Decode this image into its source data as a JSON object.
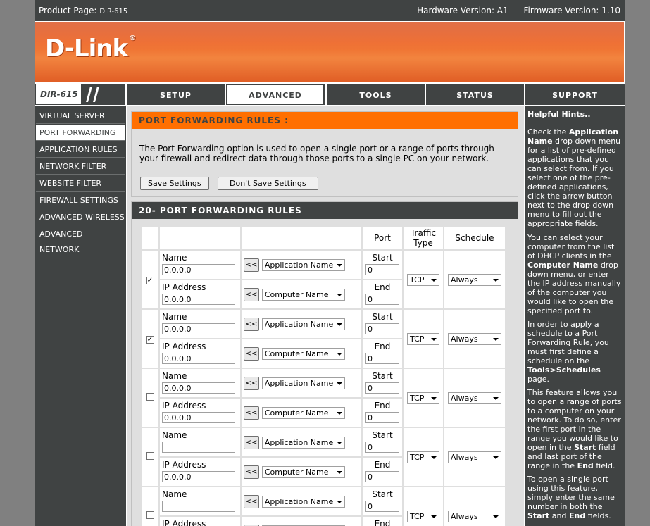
{
  "top": {
    "product_label": "Product Page:",
    "product_model": "DIR-615",
    "hardware": "Hardware Version: A1",
    "firmware": "Firmware Version: 1.10"
  },
  "brand": {
    "logo": "D-Link",
    "registered": "®"
  },
  "nav": {
    "model": "DIR-615",
    "tabs": [
      "SETUP",
      "ADVANCED",
      "TOOLS",
      "STATUS",
      "SUPPORT"
    ],
    "active_tab": "ADVANCED"
  },
  "sidebar": {
    "items": [
      "VIRTUAL SERVER",
      "PORT FORWARDING",
      "APPLICATION RULES",
      "NETWORK FILTER",
      "WEBSITE FILTER",
      "FIREWALL SETTINGS",
      "ADVANCED WIRELESS",
      "ADVANCED NETWORK"
    ],
    "active_item": "PORT FORWARDING"
  },
  "section1": {
    "title": "PORT FORWARDING RULES :",
    "description": "The Port Forwarding option is used to open a single port or a range of ports through your firewall and redirect data through those ports to a single PC on your network.",
    "save_button": "Save Settings",
    "dont_save_button": "Don't Save Settings"
  },
  "section2": {
    "title": "20- PORT FORWARDING RULES",
    "headers": {
      "port": "Port",
      "traffic_type": "Traffic Type",
      "schedule": "Schedule"
    },
    "labels": {
      "name": "Name",
      "ip_address": "IP Address",
      "start": "Start",
      "end": "End",
      "arrow": "<<",
      "application_name": "Application Name",
      "computer_name": "Computer Name"
    },
    "rules": [
      {
        "checked": true,
        "name": "0.0.0.0",
        "ip": "0.0.0.0",
        "start": "0",
        "end": "0",
        "traffic": "TCP",
        "schedule": "Always"
      },
      {
        "checked": true,
        "name": "0.0.0.0",
        "ip": "0.0.0.0",
        "start": "0",
        "end": "0",
        "traffic": "TCP",
        "schedule": "Always"
      },
      {
        "checked": false,
        "name": "0.0.0.0",
        "ip": "0.0.0.0",
        "start": "0",
        "end": "0",
        "traffic": "TCP",
        "schedule": "Always"
      },
      {
        "checked": false,
        "name": "",
        "ip": "0.0.0.0",
        "start": "0",
        "end": "0",
        "traffic": "TCP",
        "schedule": "Always"
      },
      {
        "checked": false,
        "name": "",
        "ip": "",
        "start": "0",
        "end": "",
        "traffic": "TCP",
        "schedule": "Always"
      }
    ]
  },
  "hints": {
    "title": "Helpful Hints..",
    "p1_a": "Check the ",
    "p1_b": "Application Name",
    "p1_c": " drop down menu for a list of pre-defined applications that you can select from. If you select one of the pre-defined applications, click the arrow button next to the drop down menu to fill out the appropriate fields.",
    "p2_a": "You can select your computer from the list of DHCP clients in the ",
    "p2_b": "Computer Name",
    "p2_c": " drop down menu, or enter the IP address manually of the computer you would like to open the specified port to.",
    "p3_a": "In order to apply a schedule to a Port Forwarding Rule, you must first define a schedule on the ",
    "p3_b": "Tools>Schedules",
    "p3_c": " page.",
    "p4_a": "This feature allows you to open a range of ports to a computer on your network. To do so, enter the first port in the range you would like to open in the ",
    "p4_b": "Start",
    "p4_c": " field and last port of the range in the ",
    "p4_d": "End",
    "p4_e": " field.",
    "p5_a": "To open a single port using this feature, simply enter the same number in both the ",
    "p5_b": "Start",
    "p5_c": " and ",
    "p5_d": "End",
    "p5_e": " fields."
  }
}
